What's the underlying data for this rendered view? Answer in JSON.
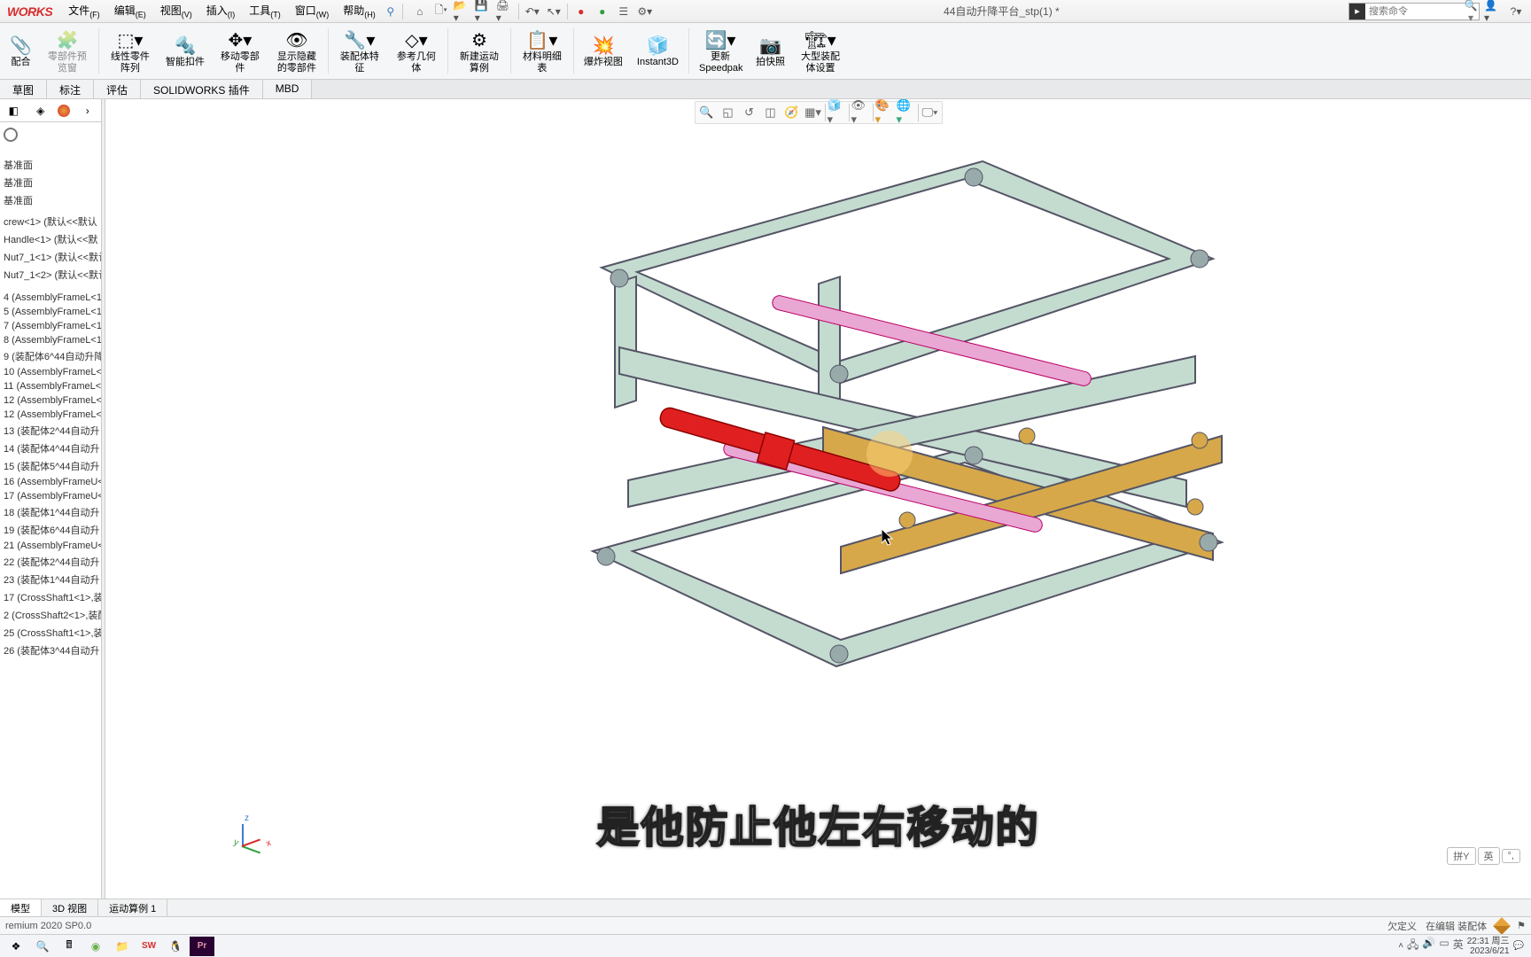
{
  "app": {
    "logo": "WORKS",
    "doc_title": "44自动升降平台_stp(1) *",
    "search_placeholder": "搜索命令"
  },
  "menu": [
    {
      "label": "文件",
      "accel": "(F)"
    },
    {
      "label": "编辑",
      "accel": "(E)"
    },
    {
      "label": "视图",
      "accel": "(V)"
    },
    {
      "label": "插入",
      "accel": "(I)"
    },
    {
      "label": "工具",
      "accel": "(T)"
    },
    {
      "label": "窗口",
      "accel": "(W)"
    },
    {
      "label": "帮助",
      "accel": "(H)"
    }
  ],
  "ribbon": [
    {
      "icon": "📎",
      "label": "配合",
      "disabled": false
    },
    {
      "icon": "🧩",
      "label": "零部件预览窗",
      "disabled": true
    },
    {
      "icon": "⬚",
      "label": "线性零件阵列",
      "disabled": false
    },
    {
      "icon": "🧱",
      "label": "智能扣件",
      "disabled": false
    },
    {
      "icon": "↔",
      "label": "移动零部件",
      "disabled": false
    },
    {
      "icon": "👁",
      "label": "显示隐藏的零部件",
      "disabled": false
    },
    {
      "icon": "🔧",
      "label": "装配体特征",
      "disabled": false
    },
    {
      "icon": "📐",
      "label": "参考几何体",
      "disabled": false
    },
    {
      "icon": "⚙",
      "label": "新建运动算例",
      "disabled": false
    },
    {
      "icon": "📋",
      "label": "材料明细表",
      "disabled": false
    },
    {
      "icon": "💥",
      "label": "爆炸视图",
      "disabled": false
    },
    {
      "icon": "⬛",
      "label": "Instant3D",
      "disabled": false
    },
    {
      "icon": "🔄",
      "label": "更新Speedpak",
      "disabled": false
    },
    {
      "icon": "📷",
      "label": "拍快照",
      "disabled": false
    },
    {
      "icon": "🏗",
      "label": "大型装配体设置",
      "disabled": false
    }
  ],
  "tabs": [
    "草图",
    "标注",
    "评估",
    "SOLIDWORKS 插件",
    "MBD"
  ],
  "tree": [
    "基准面",
    "基准面",
    "基准面",
    "",
    "crew<1> (默认<<默认",
    "Handle<1> (默认<<默",
    "Nut7_1<1> (默认<<默认",
    "Nut7_1<2> (默认<<默认",
    "",
    "",
    "4 (AssemblyFrameL<1",
    "5 (AssemblyFrameL<1",
    "7 (AssemblyFrameL<1",
    "8 (AssemblyFrameL<1",
    "9 (装配体6^44自动升降",
    "10 (AssemblyFrameL<",
    "11 (AssemblyFrameL<",
    "12 (AssemblyFrameL<",
    "12 (AssemblyFrameL<",
    "13 (装配体2^44自动升",
    "14 (装配体4^44自动升",
    "15 (装配体5^44自动升",
    "16 (AssemblyFrameU<",
    "17 (AssemblyFrameU<",
    "18 (装配体1^44自动升",
    "19 (装配体6^44自动升",
    "21 (AssemblyFrameU<",
    "22 (装配体2^44自动升",
    "23 (装配体1^44自动升",
    "17 (CrossShaft1<1>,装",
    "2 (CrossShaft2<1>,装配",
    "25 (CrossShaft1<1>,装",
    "26 (装配体3^44自动升"
  ],
  "caption": "是他防止他左右移动的",
  "motion_tabs": [
    "模型",
    "3D 视图",
    "运动算例 1"
  ],
  "status": {
    "left": "remium 2020 SP0.0",
    "right1": "欠定义",
    "right2": "在编辑 装配体"
  },
  "ime": [
    "拼Y",
    "英",
    "°,"
  ],
  "tray_time": "22:31 周三",
  "tray_date": "2023/6/21",
  "colors": {
    "accent": "#d92c2c",
    "frame": "#b8d5c8",
    "shaft_red": "#e02020",
    "shaft_pink": "#e9a7d4",
    "bar": "#d6a84a"
  }
}
